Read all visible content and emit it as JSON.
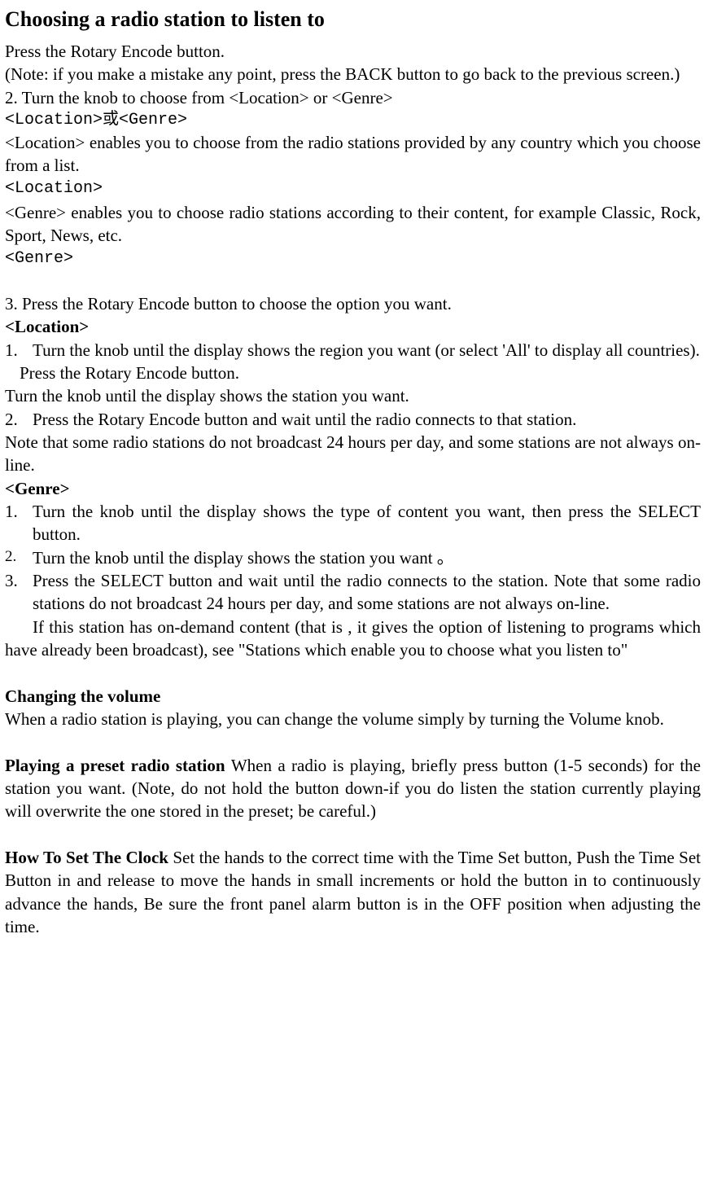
{
  "title": "Choosing a radio station to listen to",
  "p1": "Press the Rotary Encode button.",
  "p2": "(Note: if you make a mistake any point, press the BACK button to go back to the previous screen.)",
  "p3": "2. Turn the knob to choose from <Location> or <Genre>",
  "mono1": "<Location>或<Genre>",
  "p4": "<Location> enables you to choose from the radio stations provided by any country which you choose from a list.",
  "mono2": "<Location>",
  "p5": "<Genre> enables you to choose radio stations according to their content, for example Classic, Rock, Sport, News, etc.",
  "mono3": "<Genre>",
  "p6": "3. Press the Rotary Encode button to choose the option you want.",
  "locHeader": "<Location>",
  "loc1num": "1.",
  "loc1": "Turn the knob until the display shows the region you want (or select 'All' to display all countries).",
  "loc1b": "Press the Rotary Encode button.",
  "locTurn": "Turn the knob until the display shows the station you want.",
  "loc2num": "2.",
  "loc2": "Press the Rotary Encode button and wait until the radio connects to that station.",
  "locNote": "Note that some radio stations do not broadcast 24 hours per day, and some stations are not always on-line.",
  "genHeader": "<Genre>",
  "gen1num": "1.",
  "gen1": "Turn the knob until the display shows the type of content you want, then press the SELECT button.",
  "gen2num": "2.",
  "gen2": "Turn the knob until the display shows the station you want 。",
  "gen3num": "3.",
  "gen3": "Press the SELECT button and wait until the radio connects to the station.   Note that some radio stations do not broadcast 24 hours per day, and some stations are not always on-line.",
  "genIf": "If this station has on-demand content (that is , it gives the option of listening to programs which have already been broadcast), see \"Stations which enable you to choose what you listen to\"",
  "volHeader": "Changing the volume",
  "volBody": "When a radio station is playing, you can change the volume simply by turning the Volume knob.",
  "presetHeader": "Playing a preset radio station ",
  "presetBody": "When a radio is playing, briefly press button (1-5 seconds) for the station you want. (Note, do not hold the button down-if you do listen the station currently playing will overwrite the one stored in the preset; be careful.)",
  "clockHeader": "How To Set The Clock ",
  "clockBody": "Set the hands to the correct time with the Time Set button, Push the Time Set Button in and release to move the hands in small increments or hold the button in to continuously advance the hands, Be sure the front panel alarm button is in the OFF position when adjusting the time."
}
